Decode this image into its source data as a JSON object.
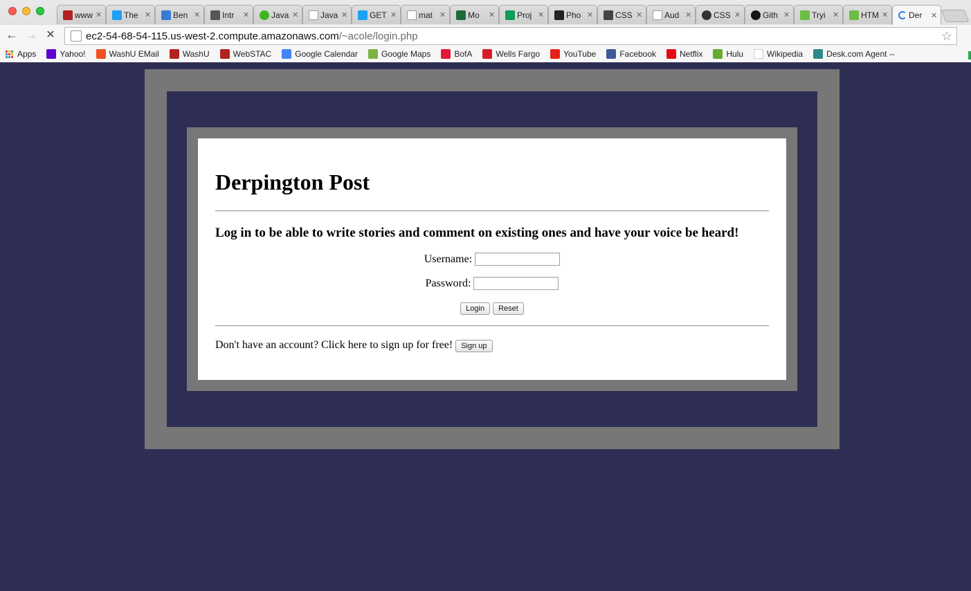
{
  "browser": {
    "tabs": [
      {
        "label": "www",
        "icon": "washu-icon",
        "color": "#b22222"
      },
      {
        "label": "The",
        "icon": "twitter-icon",
        "color": "#1da1f2"
      },
      {
        "label": "Ben",
        "icon": "site-icon",
        "color": "#3a7bd5"
      },
      {
        "label": "Intr",
        "icon": "doc-c-icon",
        "color": "#555555"
      },
      {
        "label": "Java",
        "icon": "green-ball-icon",
        "color": "#3cb521"
      },
      {
        "label": "Java",
        "icon": "page-icon",
        "color": "#999999"
      },
      {
        "label": "GET",
        "icon": "twitter-icon",
        "color": "#1da1f2"
      },
      {
        "label": "mat",
        "icon": "page-icon",
        "color": "#999999"
      },
      {
        "label": "Mo",
        "icon": "castle-icon",
        "color": "#1e6b3a"
      },
      {
        "label": "Proj",
        "icon": "sheets-icon",
        "color": "#0f9d58"
      },
      {
        "label": "Pho",
        "icon": "phnx-icon",
        "color": "#222222"
      },
      {
        "label": "CSS",
        "icon": "p-icon",
        "color": "#444444"
      },
      {
        "label": "Aud",
        "icon": "page-icon",
        "color": "#999999"
      },
      {
        "label": "CSS",
        "icon": "codepen-icon",
        "color": "#333333"
      },
      {
        "label": "Gith",
        "icon": "github-icon",
        "color": "#171515"
      },
      {
        "label": "Tryi",
        "icon": "w3-icon",
        "color": "#6bbd45"
      },
      {
        "label": "HTM",
        "icon": "w3-icon",
        "color": "#6bbd45"
      },
      {
        "label": "Der",
        "icon": "loading-spinner-icon",
        "color": "#3b78e7",
        "active": true
      }
    ],
    "url_host": "ec2-54-68-54-115.us-west-2.compute.amazonaws.com",
    "url_path": "/~acole/login.php",
    "bookmarks": [
      {
        "label": "Apps",
        "icon": "apps-grid-icon",
        "color": "#4285f4"
      },
      {
        "label": "Yahoo!",
        "icon": "yahoo-icon",
        "color": "#5f01d1"
      },
      {
        "label": "WashU EMail",
        "icon": "windows-icon",
        "color": "#f25022"
      },
      {
        "label": "WashU",
        "icon": "washu-icon",
        "color": "#b22222"
      },
      {
        "label": "WebSTAC",
        "icon": "washu-icon",
        "color": "#b22222"
      },
      {
        "label": "Google Calendar",
        "icon": "calendar-icon",
        "color": "#4285f4"
      },
      {
        "label": "Google Maps",
        "icon": "maps-icon",
        "color": "#7cb342"
      },
      {
        "label": "BofA",
        "icon": "bofa-icon",
        "color": "#e31837"
      },
      {
        "label": "Wells Fargo",
        "icon": "wellsfargo-icon",
        "color": "#d71e28"
      },
      {
        "label": "YouTube",
        "icon": "youtube-icon",
        "color": "#e62117"
      },
      {
        "label": "Facebook",
        "icon": "facebook-icon",
        "color": "#3b5998"
      },
      {
        "label": "Netflix",
        "icon": "netflix-icon",
        "color": "#e50914"
      },
      {
        "label": "Hulu",
        "icon": "hulu-icon",
        "color": "#66aa33"
      },
      {
        "label": "Wikipedia",
        "icon": "wikipedia-icon",
        "color": "#333333"
      },
      {
        "label": "Desk.com Agent -- ",
        "icon": "desk-icon",
        "color": "#2a8b8b"
      }
    ]
  },
  "page": {
    "title": "Derpington Post",
    "tagline": "Log in to be able to write stories and comment on existing ones and have your voice be heard!",
    "username_label": "Username:",
    "username_value": "",
    "password_label": "Password:",
    "password_value": "",
    "login_button": "Login",
    "reset_button": "Reset",
    "signup_text": "Don't have an account? Click here to sign up for free!",
    "signup_button": "Sign up"
  },
  "colors": {
    "page_background": "#2e2e55",
    "frame_gray": "#777777",
    "card_background": "#ffffff"
  }
}
